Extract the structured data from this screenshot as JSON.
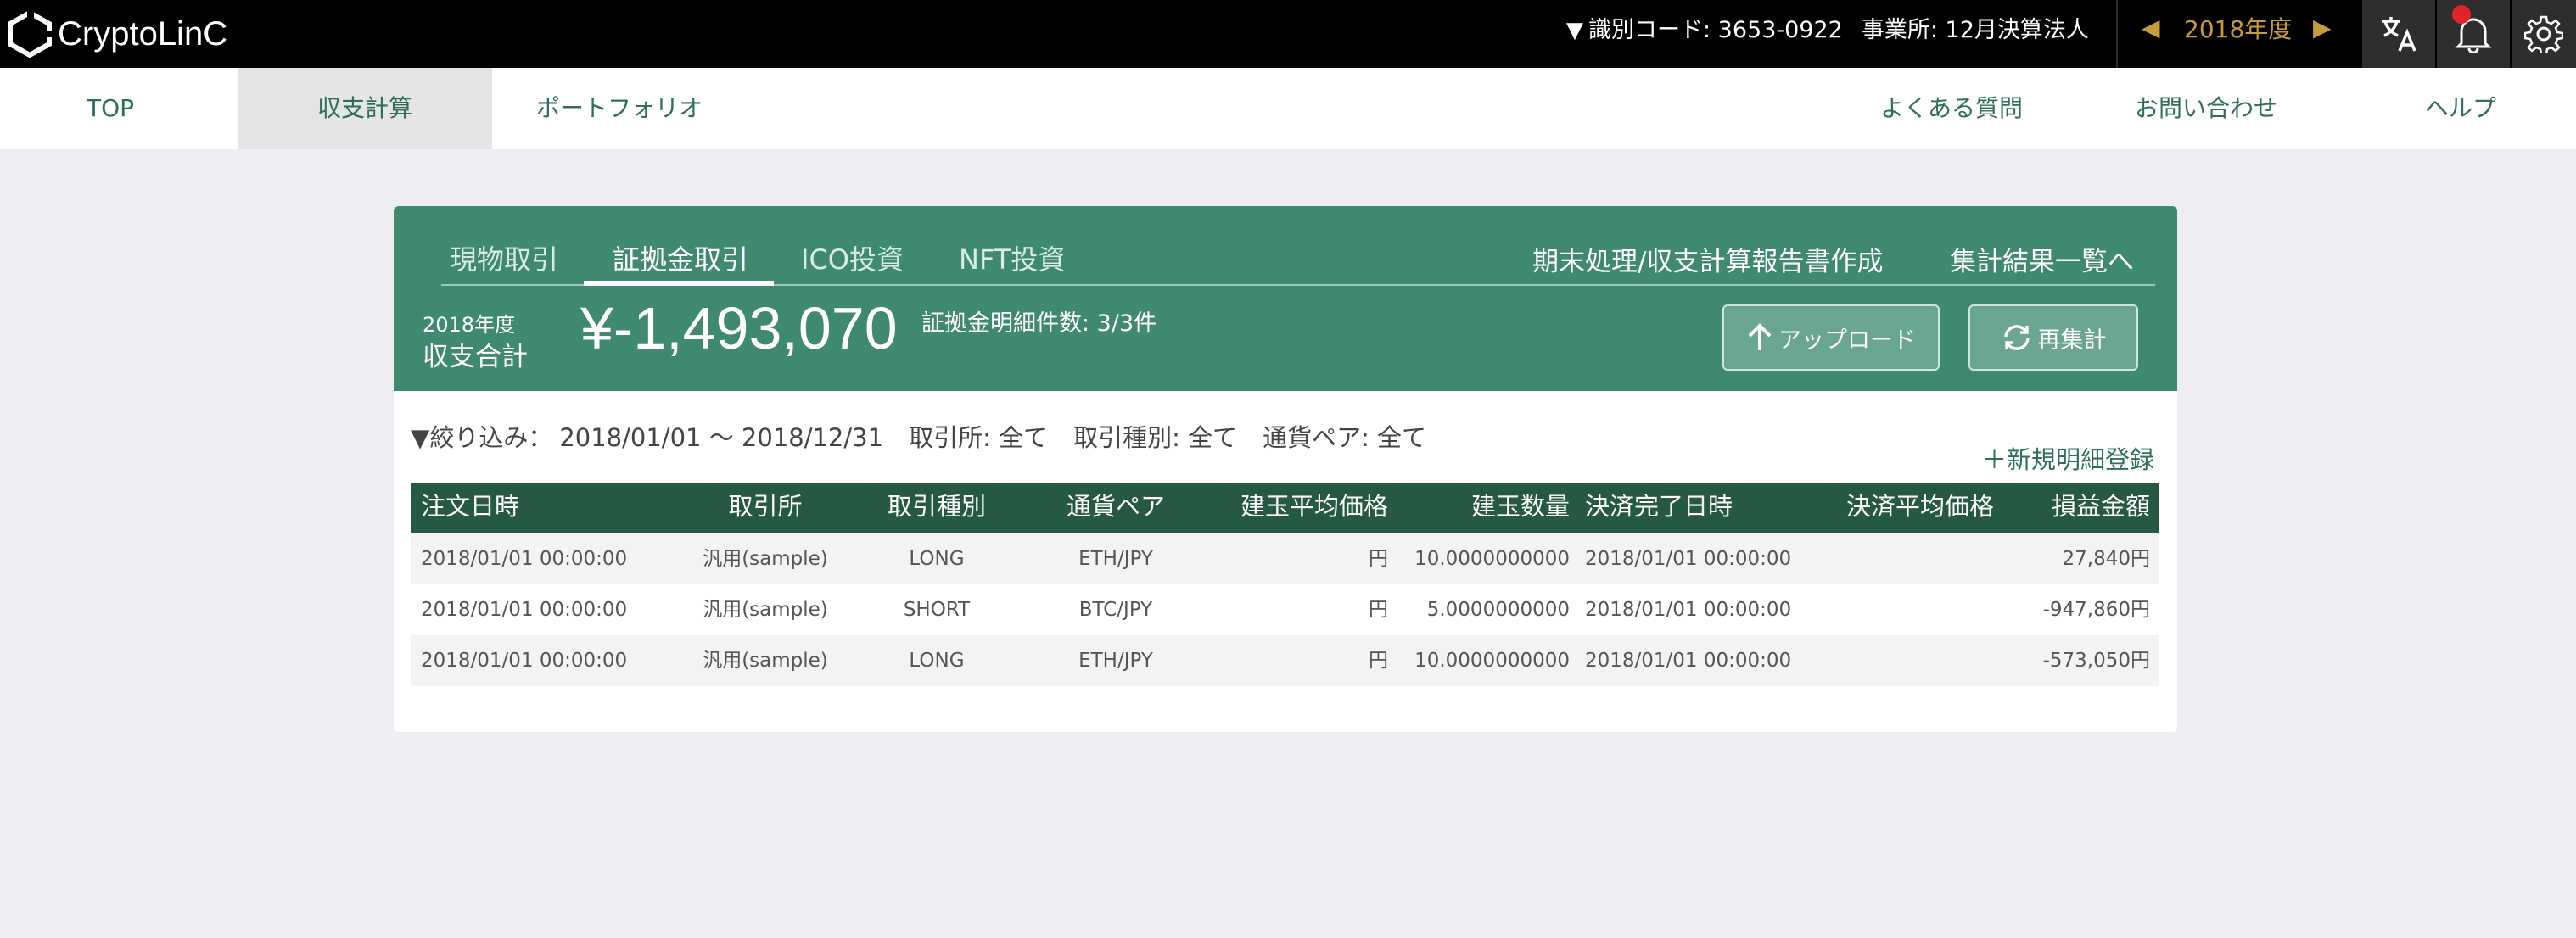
{
  "app": {
    "name": "CryptoLinC",
    "ident_label": "識別コード: 3653-0922",
    "office_label": "事業所: 12月決算法人",
    "fiscal_year": "2018年度"
  },
  "nav": {
    "items": [
      {
        "label": "TOP"
      },
      {
        "label": "収支計算"
      },
      {
        "label": "ポートフォリオ"
      },
      {
        "label": "よくある質問"
      },
      {
        "label": "お問い合わせ"
      },
      {
        "label": "ヘルプ"
      }
    ],
    "active": "収支計算"
  },
  "card": {
    "tabs": [
      {
        "label": "現物取引"
      },
      {
        "label": "証拠金取引"
      },
      {
        "label": "ICO投資"
      },
      {
        "label": "NFT投資"
      }
    ],
    "active_tab": "証拠金取引",
    "links": {
      "year_end": "期末処理/収支計算報告書作成",
      "summary": "集計結果一覧へ"
    },
    "year": "2018年度",
    "total_label": "収支合計",
    "total_amount": "¥-1,493,070",
    "detail_count": "証拠金明細件数: 3/3件",
    "upload_label": "アップロード",
    "recalc_label": "再集計"
  },
  "filter": {
    "prefix": "絞り込み：",
    "date_range": "2018/01/01 〜 2018/12/31",
    "exchange": "取引所: 全て",
    "trade_type": "取引種別: 全て",
    "pair": "通貨ペア: 全て"
  },
  "new_entry_label": "新規明細登録",
  "table": {
    "headers": [
      "注文日時",
      "取引所",
      "取引種別",
      "通貨ペア",
      "建玉平均価格",
      "建玉数量",
      "決済完了日時",
      "決済平均価格",
      "損益金額"
    ],
    "rows": [
      [
        "2018/01/01 00:00:00",
        "汎用(sample)",
        "LONG",
        "ETH/JPY",
        "円",
        "10.0000000000",
        "2018/01/01 00:00:00",
        "",
        "27,840円"
      ],
      [
        "2018/01/01 00:00:00",
        "汎用(sample)",
        "SHORT",
        "BTC/JPY",
        "円",
        "5.0000000000",
        "2018/01/01 00:00:00",
        "",
        "-947,860円"
      ],
      [
        "2018/01/01 00:00:00",
        "汎用(sample)",
        "LONG",
        "ETH/JPY",
        "円",
        "10.0000000000",
        "2018/01/01 00:00:00",
        "",
        "-573,050円"
      ]
    ]
  },
  "colors": {
    "brand_green": "#3f8a6f",
    "table_header": "#255943",
    "nav_text": "#2f6f58",
    "year_gold": "#c79a3a",
    "notification": "#e0242b"
  }
}
